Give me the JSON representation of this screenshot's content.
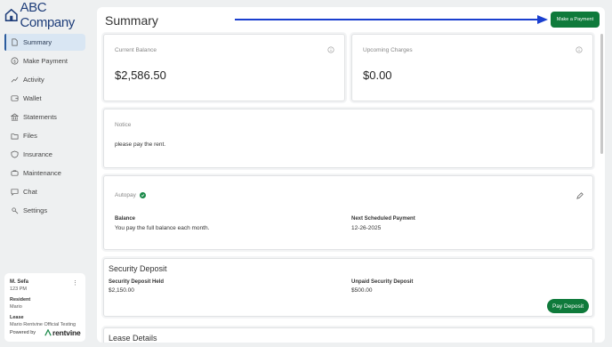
{
  "brand": {
    "name": "ABC Company",
    "accent": "#1f3e7a"
  },
  "sidebar": {
    "items": [
      {
        "label": "Summary",
        "icon": "document-icon",
        "active": true
      },
      {
        "label": "Make Payment",
        "icon": "dollar-circle-icon"
      },
      {
        "label": "Activity",
        "icon": "trend-line-icon"
      },
      {
        "label": "Wallet",
        "icon": "wallet-icon"
      },
      {
        "label": "Statements",
        "icon": "bank-icon"
      },
      {
        "label": "Files",
        "icon": "folder-icon"
      },
      {
        "label": "Insurance",
        "icon": "shield-icon"
      },
      {
        "label": "Maintenance",
        "icon": "toolbox-icon"
      },
      {
        "label": "Chat",
        "icon": "chat-icon"
      },
      {
        "label": "Settings",
        "icon": "settings-icon"
      }
    ]
  },
  "user": {
    "name": "M. Sefa",
    "time": "123 PM",
    "role_label": "Resident",
    "role_value": "Mario",
    "lease_label": "Lease",
    "lease_value": "Mario Rentvine Official Testing",
    "powered_by": "Powered by",
    "powered_brand": "rentvine"
  },
  "header": {
    "title": "Summary",
    "make_payment_label": "Make a Payment",
    "button_color": "#0f7a3b"
  },
  "current_balance": {
    "label": "Current Balance",
    "value": "$2,586.50"
  },
  "upcoming_charges": {
    "label": "Upcoming Charges",
    "value": "$0.00"
  },
  "notice": {
    "label": "Notice",
    "text": "please pay the rent."
  },
  "autopay": {
    "label": "Autopay",
    "balance_label": "Balance",
    "balance_text": "You pay the full balance each month.",
    "next_label": "Next Scheduled Payment",
    "next_date": "12-26-2025"
  },
  "security_deposit": {
    "title": "Security Deposit",
    "held_label": "Security Deposit Held",
    "held_value": "$2,150.00",
    "unpaid_label": "Unpaid Security Deposit",
    "unpaid_value": "$500.00",
    "pay_label": "Pay Deposit"
  },
  "lease_details": {
    "title": "Lease Details"
  }
}
